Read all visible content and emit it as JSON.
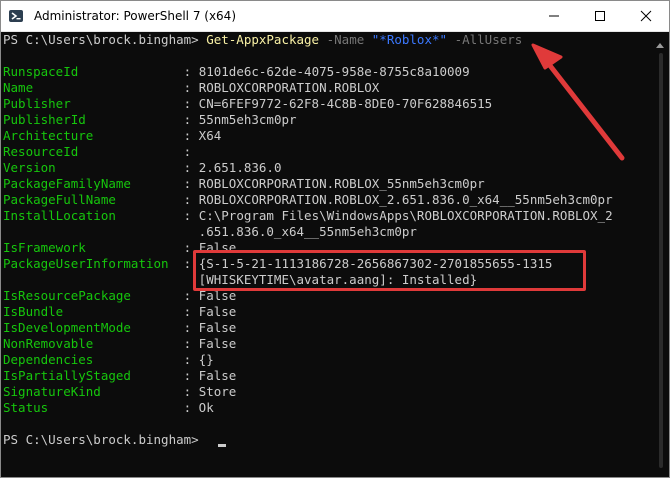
{
  "window": {
    "title": "Administrator: PowerShell 7 (x64)",
    "icons": [
      "powershell-icon",
      "minimize-icon",
      "maximize-icon",
      "close-icon"
    ]
  },
  "command": {
    "prompt": "PS C:\\Users\\brock.bingham> ",
    "cmdlet": "Get-AppxPackage",
    "param_name": " -Name ",
    "name_value": "\"*Roblox*\"",
    "param_allusers": " -AllUsers"
  },
  "properties": [
    {
      "name": "RunspaceId",
      "value": "8101de6c-62de-4075-958e-8755c8a10009"
    },
    {
      "name": "Name",
      "value": "ROBLOXCORPORATION.ROBLOX"
    },
    {
      "name": "Publisher",
      "value": "CN=6FEF9772-62F8-4C8B-8DE0-70F628846515"
    },
    {
      "name": "PublisherId",
      "value": "55nm5eh3cm0pr"
    },
    {
      "name": "Architecture",
      "value": "X64"
    },
    {
      "name": "ResourceId",
      "value": ""
    },
    {
      "name": "Version",
      "value": "2.651.836.0"
    },
    {
      "name": "PackageFamilyName",
      "value": "ROBLOXCORPORATION.ROBLOX_55nm5eh3cm0pr"
    },
    {
      "name": "PackageFullName",
      "value": "ROBLOXCORPORATION.ROBLOX_2.651.836.0_x64__55nm5eh3cm0pr"
    },
    {
      "name": "InstallLocation",
      "value": "C:\\Program Files\\WindowsApps\\ROBLOXCORPORATION.ROBLOX_2"
    },
    {
      "name": "",
      "value": ".651.836.0_x64__55nm5eh3cm0pr",
      "continuation": true
    },
    {
      "name": "IsFramework",
      "value": "False"
    },
    {
      "name": "PackageUserInformation",
      "value": "{S-1-5-21-1113186728-2656867302-2701855655-1315"
    },
    {
      "name": "",
      "value": "[WHISKEYTIME\\avatar.aang]: Installed}",
      "continuation": true
    },
    {
      "name": "IsResourcePackage",
      "value": "False"
    },
    {
      "name": "IsBundle",
      "value": "False"
    },
    {
      "name": "IsDevelopmentMode",
      "value": "False"
    },
    {
      "name": "NonRemovable",
      "value": "False"
    },
    {
      "name": "Dependencies",
      "value": "{}"
    },
    {
      "name": "IsPartiallyStaged",
      "value": "False"
    },
    {
      "name": "SignatureKind",
      "value": "Store"
    },
    {
      "name": "Status",
      "value": "Ok"
    }
  ],
  "final_prompt": "PS C:\\Users\\brock.bingham> ",
  "annotation_color": "#e03a3a"
}
